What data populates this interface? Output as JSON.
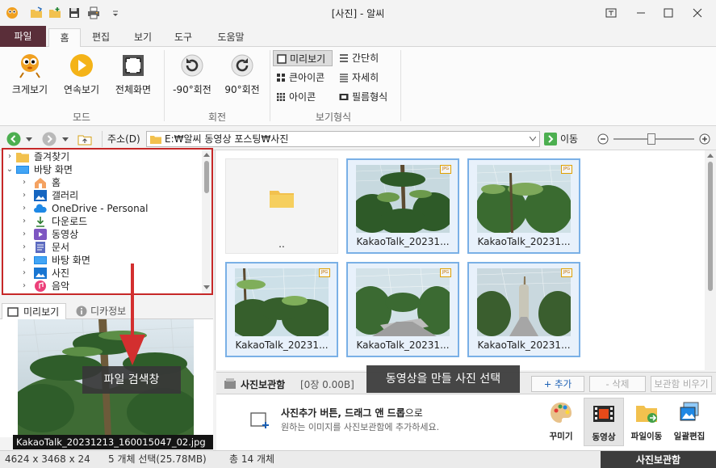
{
  "window": {
    "title": "[사진] - 알씨",
    "controls": [
      "restore-view",
      "minimize",
      "maximize",
      "close"
    ]
  },
  "menu_tabs": [
    {
      "label": "파일",
      "key": "file"
    },
    {
      "label": "홈",
      "key": "home",
      "active": true
    },
    {
      "label": "편집",
      "key": "edit"
    },
    {
      "label": "보기",
      "key": "view"
    },
    {
      "label": "도구",
      "key": "tools"
    },
    {
      "label": "도움말",
      "key": "help"
    }
  ],
  "ribbon": {
    "mode_group": {
      "label": "모드",
      "buttons": [
        {
          "label": "크게보기",
          "icon": "mascot-icon"
        },
        {
          "label": "연속보기",
          "icon": "play-icon"
        },
        {
          "label": "전체화면",
          "icon": "fullscreen-icon"
        }
      ]
    },
    "rotate_group": {
      "label": "회전",
      "buttons": [
        {
          "label": "-90°회전",
          "icon": "rotate-left-icon"
        },
        {
          "label": "90°회전",
          "icon": "rotate-right-icon"
        }
      ]
    },
    "view_group": {
      "label": "보기형식",
      "options": [
        {
          "label": "미리보기",
          "selected": true
        },
        {
          "label": "간단히"
        },
        {
          "label": "큰아이콘"
        },
        {
          "label": "자세히"
        },
        {
          "label": "아이콘"
        },
        {
          "label": "필름형식"
        }
      ]
    }
  },
  "address": {
    "label": "주소(D)",
    "path": "E:₩알씨 동영상 포스팅₩사진",
    "go_label": "이동"
  },
  "tree": {
    "items": [
      {
        "label": "즐겨찾기",
        "expanded": false,
        "indent": 0,
        "icon": "star-folder-icon"
      },
      {
        "label": "바탕 화면",
        "expanded": true,
        "indent": 0,
        "icon": "desktop-icon"
      },
      {
        "label": "홈",
        "indent": 1,
        "icon": "home-icon"
      },
      {
        "label": "갤러리",
        "indent": 1,
        "icon": "gallery-icon"
      },
      {
        "label": "OneDrive - Personal",
        "indent": 1,
        "icon": "cloud-icon"
      },
      {
        "label": "다운로드",
        "indent": 1,
        "icon": "download-icon"
      },
      {
        "label": "동영상",
        "indent": 1,
        "icon": "video-icon"
      },
      {
        "label": "문서",
        "indent": 1,
        "icon": "document-icon"
      },
      {
        "label": "바탕 화면",
        "indent": 1,
        "icon": "desktop-icon"
      },
      {
        "label": "사진",
        "indent": 1,
        "icon": "picture-icon"
      },
      {
        "label": "음악",
        "indent": 1,
        "icon": "music-icon"
      }
    ]
  },
  "preview": {
    "tabs": [
      {
        "label": "미리보기",
        "active": true
      },
      {
        "label": "디카정보"
      }
    ],
    "filename": "KakaoTalk_20231213_160015047_02.jpg"
  },
  "grid": {
    "items": [
      {
        "caption": "..",
        "type": "folder"
      },
      {
        "caption": "KakaoTalk_20231...",
        "type": "photo",
        "selected": true
      },
      {
        "caption": "KakaoTalk_20231...",
        "type": "photo",
        "selected": true
      },
      {
        "caption": "KakaoTalk_20231...",
        "type": "photo",
        "selected": true
      },
      {
        "caption": "KakaoTalk_20231...",
        "type": "photo",
        "selected": true
      },
      {
        "caption": "KakaoTalk_20231...",
        "type": "photo",
        "selected": true
      }
    ],
    "badge": "JPG"
  },
  "photo_box": {
    "title": "사진보관함",
    "count": "[0장 0.00B]",
    "add_label": "+ 추가",
    "delete_label": "- 삭제",
    "empty_label": "보관함 비우기",
    "hint_title_bold": "사진추가 버튼, 드래그 앤 드롭",
    "hint_title_rest": "으로",
    "hint_sub": "원하는 이미지를 사진보관함에 추가하세요.",
    "tools": [
      {
        "label": "꾸미기",
        "icon": "palette-icon"
      },
      {
        "label": "동영상",
        "icon": "film-icon",
        "active": true
      },
      {
        "label": "파일이동",
        "icon": "folder-move-icon"
      },
      {
        "label": "일괄편집",
        "icon": "batch-edit-icon"
      }
    ]
  },
  "status": {
    "dimensions": "4624 x 3468 x 24",
    "selection": "5 개체 선택(25.78MB)",
    "total": "총 14 개체",
    "box_tab": "사진보관함"
  },
  "annotations": {
    "search_pane_label": "파일 검색창",
    "select_photos_label": "동영상을 만들 사진 선택"
  },
  "colors": {
    "file_tab": "#5a2e39",
    "highlight_border": "#c62828",
    "selection_border": "#7ab0e6",
    "annotation_bg": "#373737"
  }
}
